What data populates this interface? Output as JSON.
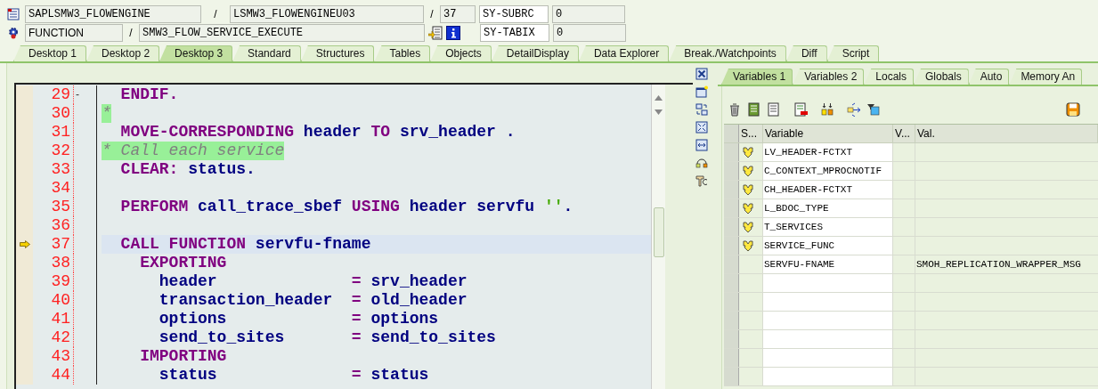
{
  "header": {
    "program": "SAPLSMW3_FLOWENGINE",
    "separator_1": "/",
    "include": "LSMW3_FLOWENGINEU03",
    "separator_2": "/",
    "line": "37",
    "field_1_name": "SY-SUBRC",
    "field_1_value": "0",
    "event_type": "FUNCTION",
    "separator_3": "/",
    "event": "SMW3_FLOW_SERVICE_EXECUTE",
    "field_2_name": "SY-TABIX",
    "field_2_value": "0"
  },
  "desktop_tabs": [
    {
      "label": "Desktop 1",
      "selected": false
    },
    {
      "label": "Desktop 2",
      "selected": false
    },
    {
      "label": "Desktop 3",
      "selected": true
    },
    {
      "label": "Standard",
      "selected": false
    },
    {
      "label": "Structures",
      "selected": false
    },
    {
      "label": "Tables",
      "selected": false
    },
    {
      "label": "Objects",
      "selected": false
    },
    {
      "label": "DetailDisplay",
      "selected": false
    },
    {
      "label": "Data Explorer",
      "selected": false
    },
    {
      "label": "Break./Watchpoints",
      "selected": false
    },
    {
      "label": "Diff",
      "selected": false
    },
    {
      "label": "Script",
      "selected": false
    }
  ],
  "code": {
    "lines": [
      {
        "number": "29",
        "current": false,
        "fold": "-",
        "tokens": [
          {
            "kind": "keyword",
            "text": "  ENDIF."
          }
        ]
      },
      {
        "number": "30",
        "current": false,
        "tokens": [
          {
            "kind": "comment",
            "text": "*"
          }
        ]
      },
      {
        "number": "31",
        "current": false,
        "tokens": [
          {
            "kind": "keyword",
            "text": "  MOVE-CORRESPONDING"
          },
          {
            "kind": "name",
            "text": " header "
          },
          {
            "kind": "keyword",
            "text": "TO"
          },
          {
            "kind": "name",
            "text": " srv_header ."
          }
        ]
      },
      {
        "number": "32",
        "current": false,
        "tokens": [
          {
            "kind": "comment",
            "text": "* Call each service"
          }
        ]
      },
      {
        "number": "33",
        "current": false,
        "tokens": [
          {
            "kind": "keyword",
            "text": "  CLEAR:"
          },
          {
            "kind": "name",
            "text": " status."
          }
        ]
      },
      {
        "number": "34",
        "current": false
      },
      {
        "number": "35",
        "current": false,
        "tokens": [
          {
            "kind": "keyword",
            "text": "  PERFORM"
          },
          {
            "kind": "name",
            "text": " call_trace_sbef "
          },
          {
            "kind": "keyword",
            "text": "USING"
          },
          {
            "kind": "name",
            "text": " header servfu "
          },
          {
            "kind": "string",
            "text": "''"
          },
          {
            "kind": "name",
            "text": "."
          }
        ]
      },
      {
        "number": "36",
        "current": false
      },
      {
        "number": "37",
        "current": true,
        "tokens": [
          {
            "kind": "keyword",
            "text": "  CALL FUNCTION"
          },
          {
            "kind": "name",
            "text": " servfu-fname"
          }
        ]
      },
      {
        "number": "38",
        "current": false,
        "tokens": [
          {
            "kind": "keyword",
            "text": "    EXPORTING"
          }
        ]
      },
      {
        "number": "39",
        "current": false,
        "tokens": [
          {
            "kind": "name",
            "text": "      header              "
          },
          {
            "kind": "operator",
            "text": "="
          },
          {
            "kind": "name",
            "text": " srv_header"
          }
        ]
      },
      {
        "number": "40",
        "current": false,
        "tokens": [
          {
            "kind": "name",
            "text": "      transaction_header  "
          },
          {
            "kind": "operator",
            "text": "="
          },
          {
            "kind": "name",
            "text": " old_header"
          }
        ]
      },
      {
        "number": "41",
        "current": false,
        "tokens": [
          {
            "kind": "name",
            "text": "      options             "
          },
          {
            "kind": "operator",
            "text": "="
          },
          {
            "kind": "name",
            "text": " options"
          }
        ]
      },
      {
        "number": "42",
        "current": false,
        "tokens": [
          {
            "kind": "name",
            "text": "      send_to_sites       "
          },
          {
            "kind": "operator",
            "text": "="
          },
          {
            "kind": "name",
            "text": " send_to_sites"
          }
        ]
      },
      {
        "number": "43",
        "current": false,
        "tokens": [
          {
            "kind": "keyword",
            "text": "    IMPORTING"
          }
        ]
      },
      {
        "number": "44",
        "current": false,
        "tokens": [
          {
            "kind": "name",
            "text": "      status              "
          },
          {
            "kind": "operator",
            "text": "="
          },
          {
            "kind": "name",
            "text": " status"
          }
        ]
      }
    ]
  },
  "variable_tabs": [
    {
      "label": "Variables 1",
      "selected": true
    },
    {
      "label": "Variables 2",
      "selected": false
    },
    {
      "label": "Locals",
      "selected": false
    },
    {
      "label": "Globals",
      "selected": false
    },
    {
      "label": "Auto",
      "selected": false
    },
    {
      "label": "Memory An",
      "selected": false
    }
  ],
  "variables": {
    "columns": [
      "S...",
      "Variable",
      "V...",
      "Val."
    ],
    "rows": [
      {
        "changed": true,
        "variable": "LV_HEADER-FCTXT"
      },
      {
        "changed": true,
        "variable": "C_CONTEXT_MPROCNOTIF"
      },
      {
        "changed": true,
        "variable": "CH_HEADER-FCTXT"
      },
      {
        "changed": true,
        "variable": "L_BDOC_TYPE"
      },
      {
        "changed": true,
        "variable": "T_SERVICES"
      },
      {
        "changed": true,
        "variable": "SERVICE_FUNC"
      },
      {
        "changed": false,
        "variable": "SERVFU-FNAME",
        "value": "SMOH_REPLICATION_WRAPPER_MSG"
      }
    ]
  }
}
